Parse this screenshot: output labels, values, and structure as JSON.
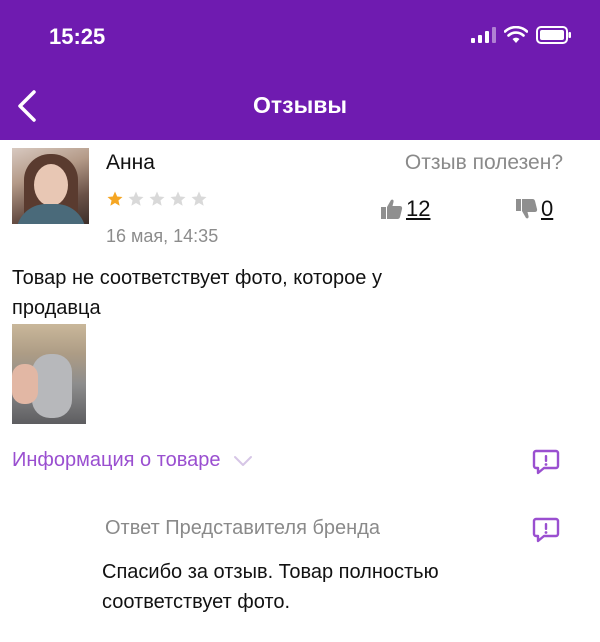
{
  "status_bar": {
    "time": "15:25"
  },
  "header": {
    "title": "Отзывы",
    "back_icon": "chevron-left-icon"
  },
  "review": {
    "author": "Анна",
    "rating": 1,
    "rating_max": 5,
    "date": "16 мая, 14:35",
    "helpful_label": "Отзыв полезен?",
    "likes": "12",
    "dislikes": "0",
    "text": "Товар не соответствует фото, которое у продавца"
  },
  "product_info": {
    "label": "Информация о товаре"
  },
  "brand_reply": {
    "title": "Ответ Представителя бренда",
    "text": "Спасибо за отзыв. Товар полностью соответствует фото."
  },
  "colors": {
    "header": "#6f1bb0",
    "accent": "#9a4fd0",
    "star_active": "#f5a623",
    "star_inactive": "#d9d9d9",
    "muted": "#8a8a8a"
  }
}
